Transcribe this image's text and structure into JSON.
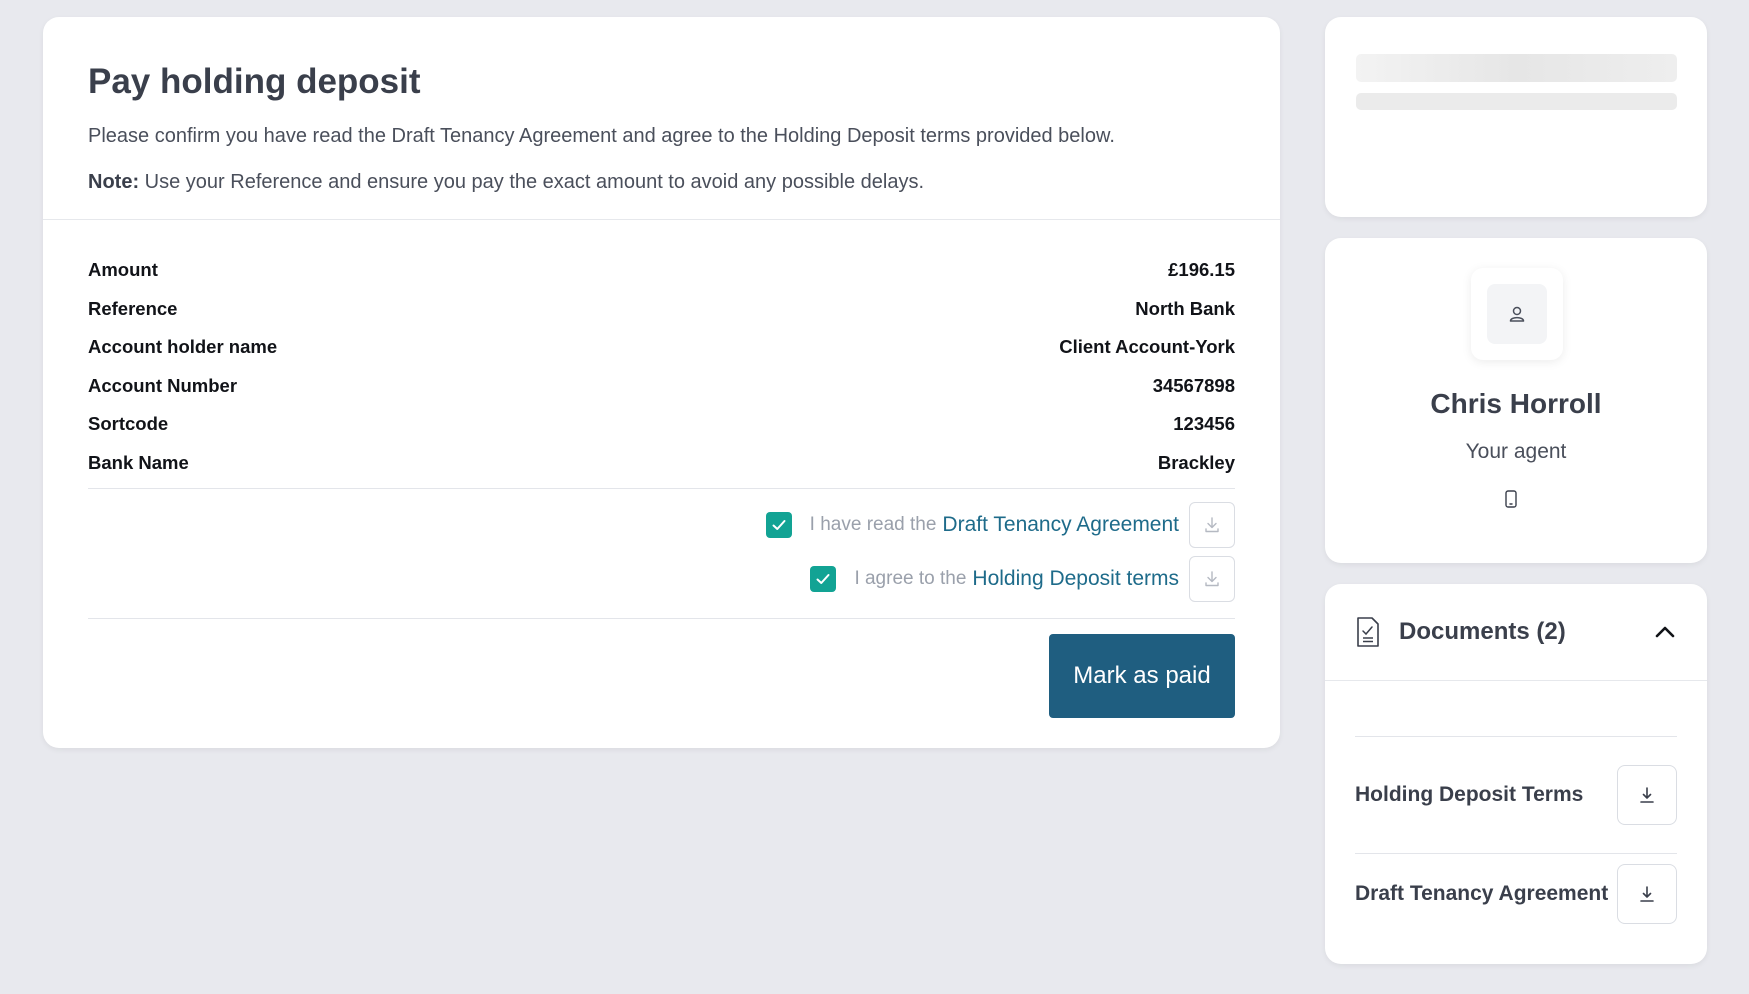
{
  "payment": {
    "title": "Pay holding deposit",
    "intro": "Please confirm you have read the Draft Tenancy Agreement and agree to the Holding Deposit terms provided below.",
    "note_label": "Note:",
    "note_text": " Use your Reference and ensure you pay the exact amount to avoid any possible delays.",
    "details": [
      {
        "label": "Amount",
        "value": "£196.15"
      },
      {
        "label": "Reference",
        "value": "North Bank"
      },
      {
        "label": "Account holder name",
        "value": "Client Account-York"
      },
      {
        "label": "Account Number",
        "value": "34567898"
      },
      {
        "label": "Sortcode",
        "value": "123456"
      },
      {
        "label": "Bank Name",
        "value": "Brackley"
      }
    ],
    "acknowledgements": [
      {
        "prefix": "I have read the",
        "link": "Draft Tenancy Agreement",
        "checked": true
      },
      {
        "prefix": "I agree to the",
        "link": "Holding Deposit terms",
        "checked": true
      }
    ],
    "mark_paid_label": "Mark as paid"
  },
  "agent": {
    "name": "Chris Horroll",
    "role": "Your agent",
    "avatar_icon": "user-icon",
    "phone_icon": "mobile-phone-icon"
  },
  "documents": {
    "title": "Documents (2)",
    "expanded": true,
    "items": [
      {
        "label": "Holding Deposit Terms"
      },
      {
        "label": "Draft Tenancy Agreement"
      }
    ]
  },
  "colors": {
    "accent": "#1f5e80",
    "checkbox": "#12a394",
    "link": "#1e6b8a",
    "background": "#e8e9ee"
  }
}
